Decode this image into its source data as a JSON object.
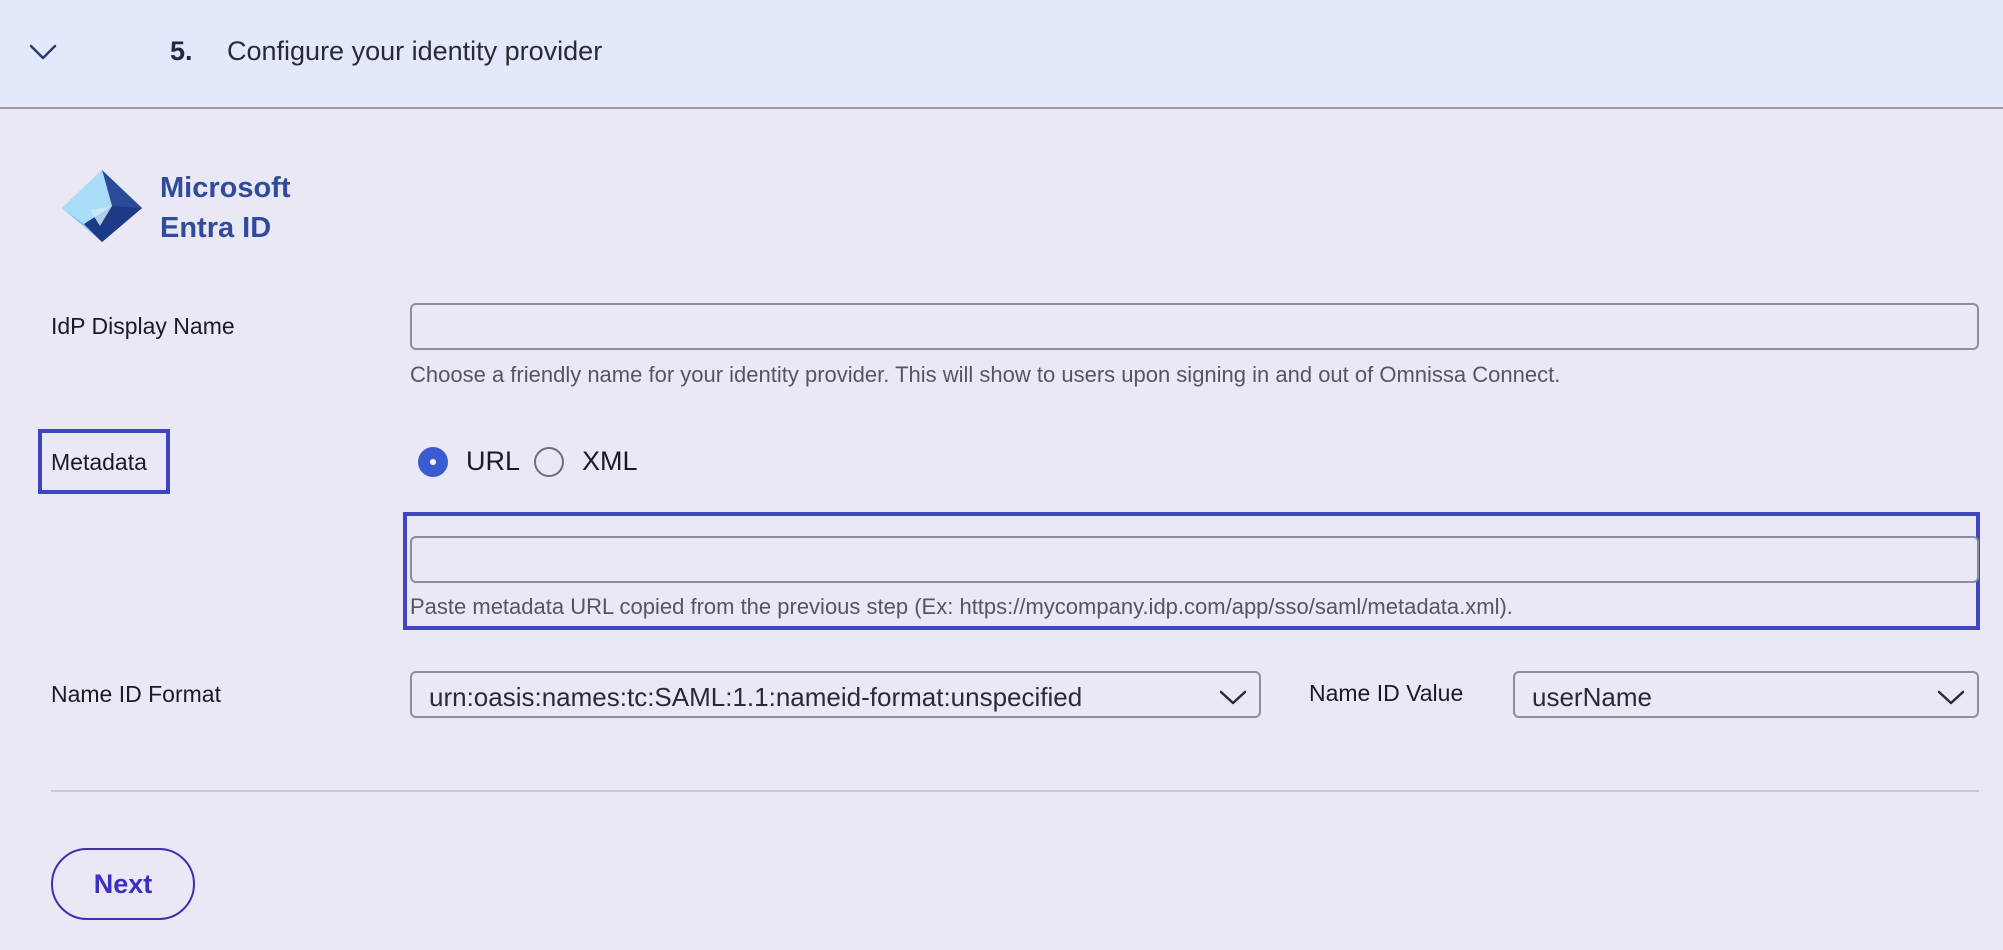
{
  "header": {
    "step_number": "5.",
    "step_title": "Configure your identity provider"
  },
  "provider": {
    "name_line1": "Microsoft",
    "name_line2": "Entra ID",
    "logo_icon": "microsoft-entra-id-logo"
  },
  "idp_display_name": {
    "label": "IdP Display Name",
    "value": "",
    "help": "Choose a friendly name for your identity provider. This will show to users upon signing in and out of Omnissa Connect."
  },
  "metadata": {
    "label": "Metadata",
    "options": [
      {
        "label": "URL",
        "selected": true
      },
      {
        "label": "XML",
        "selected": false
      }
    ],
    "url_value": "",
    "help": "Paste metadata URL copied from the previous step (Ex: https://mycompany.idp.com/app/sso/saml/metadata.xml)."
  },
  "name_id_format": {
    "label": "Name ID Format",
    "selected": "urn:oasis:names:tc:SAML:1.1:nameid-format:unspecified"
  },
  "name_id_value": {
    "label": "Name ID Value",
    "selected": "userName"
  },
  "actions": {
    "next_label": "Next"
  },
  "colors": {
    "accent": "#3b5bd0",
    "highlight_border": "#3f46c0",
    "button_text": "#3b2ec0",
    "brand_text": "#2f4b9b"
  }
}
